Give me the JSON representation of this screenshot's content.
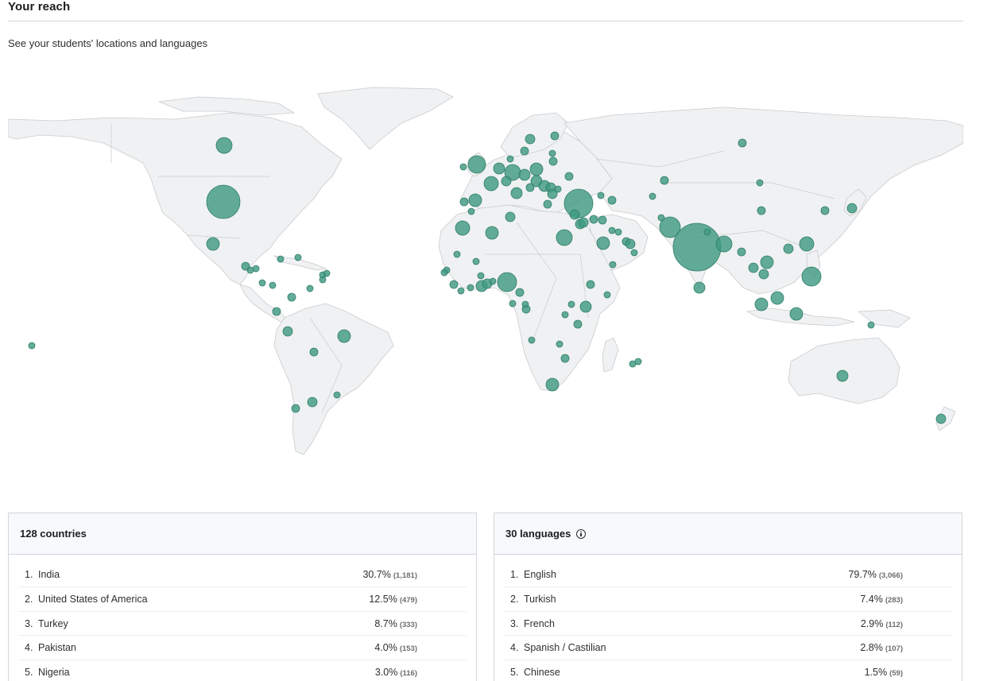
{
  "header": {
    "title": "Your reach",
    "subtitle": "See your students' locations and languages"
  },
  "map": {
    "bubble_color": "#3f9a82",
    "land_color": "#f0f1f2"
  },
  "countries_panel": {
    "title": "128 countries",
    "rows": [
      {
        "rank": "1.",
        "name": "India",
        "percent": "30.7%",
        "count": "(1,181)"
      },
      {
        "rank": "2.",
        "name": "United States of America",
        "percent": "12.5%",
        "count": "(479)"
      },
      {
        "rank": "3.",
        "name": "Turkey",
        "percent": "8.7%",
        "count": "(333)"
      },
      {
        "rank": "4.",
        "name": "Pakistan",
        "percent": "4.0%",
        "count": "(153)"
      },
      {
        "rank": "5.",
        "name": "Nigeria",
        "percent": "3.0%",
        "count": "(116)"
      }
    ]
  },
  "languages_panel": {
    "title": "30 languages",
    "info_icon": "info-icon",
    "rows": [
      {
        "rank": "1.",
        "name": "English",
        "percent": "79.7%",
        "count": "(3,066)"
      },
      {
        "rank": "2.",
        "name": "Turkish",
        "percent": "7.4%",
        "count": "(283)"
      },
      {
        "rank": "3.",
        "name": "French",
        "percent": "2.9%",
        "count": "(112)"
      },
      {
        "rank": "4.",
        "name": "Spanish / Castilian",
        "percent": "2.8%",
        "count": "(107)"
      },
      {
        "rank": "5.",
        "name": "Chinese",
        "percent": "1.5%",
        "count": "(59)"
      }
    ]
  }
}
